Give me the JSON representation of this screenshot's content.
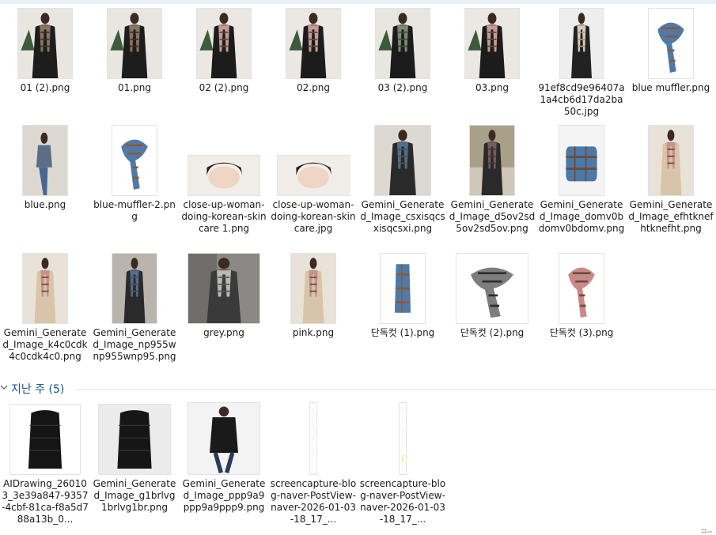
{
  "files_recent": [
    {
      "name": "01 (2).png",
      "thumb": "coat-plaid-brown"
    },
    {
      "name": "01.png",
      "thumb": "coat-plaid-brown"
    },
    {
      "name": "02 (2).png",
      "thumb": "coat-plaid-pink"
    },
    {
      "name": "02.png",
      "thumb": "coat-plaid-pink"
    },
    {
      "name": "03 (2).png",
      "thumb": "coat-plaid-green"
    },
    {
      "name": "03.png",
      "thumb": "coat-plaid-pink"
    },
    {
      "name": "91ef8cd9e96407a1a4cb6d17da2ba50c.jpg",
      "thumb": "street-beige"
    },
    {
      "name": "blue muffler.png",
      "thumb": "scarf-blue"
    },
    {
      "name": "blue.png",
      "thumb": "street-blue"
    },
    {
      "name": "blue-muffler-2.png",
      "thumb": "scarf-blue"
    },
    {
      "name": "close-up-woman-doing-korean-skincare 1.png",
      "thumb": "face"
    },
    {
      "name": "close-up-woman-doing-korean-skincare.jpg",
      "thumb": "face"
    },
    {
      "name": "Gemini_Generated_Image_csxisqcsxisqcsxi.png",
      "thumb": "model-blue-plaid"
    },
    {
      "name": "Gemini_Generated_Image_d5ov2sd5ov2sd5ov.png",
      "thumb": "street-plaid"
    },
    {
      "name": "Gemini_Generated_Image_domv0bdomv0bdomv.png",
      "thumb": "folded-blue"
    },
    {
      "name": "Gemini_Generated_Image_efhtknefhtknefht.png",
      "thumb": "model-pink-beige"
    },
    {
      "name": "Gemini_Generated_Image_k4c0cdk4c0cdk4c0.png",
      "thumb": "model-pink-beige"
    },
    {
      "name": "Gemini_Generated_Image_np955wnp955wnp95.png",
      "thumb": "street-blue-plaid"
    },
    {
      "name": "grey.png",
      "thumb": "street-grey"
    },
    {
      "name": "pink.png",
      "thumb": "model-pink-beige"
    },
    {
      "name": "단독컷 (1).png",
      "thumb": "scarf-blue-hang"
    },
    {
      "name": "단독컷 (2).png",
      "thumb": "scarf-grey"
    },
    {
      "name": "단독컷 (3).png",
      "thumb": "scarf-pink"
    }
  ],
  "group_last_week": {
    "title": "지난 주 (5)",
    "files": [
      {
        "name": "AIDrawing_260103_3e39a847-9357-4cbf-81ca-f8a5d788a13b_0...",
        "thumb": "padding-black"
      },
      {
        "name": "Gemini_Generated_Image_g1brlvg1brlvg1br.png",
        "thumb": "padding-black-grey"
      },
      {
        "name": "Gemini_Generated_Image_ppp9a9ppp9a9ppp9.png",
        "thumb": "model-padding"
      },
      {
        "name": "screencapture-blog-naver-PostView-naver-2026-01-03-18_17_...",
        "thumb": "long-capture"
      },
      {
        "name": "screencapture-blog-naver-PostView-naver-2026-01-03-18_17_...",
        "thumb": "long-capture-2"
      }
    ]
  }
}
